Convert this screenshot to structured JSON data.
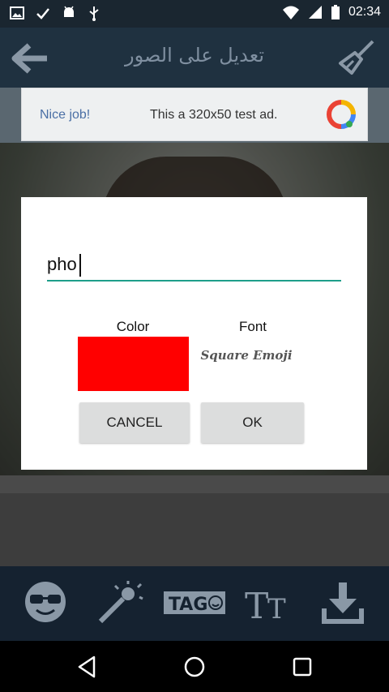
{
  "status_bar": {
    "time": "02:34",
    "icons": [
      "image-icon",
      "check-icon",
      "android-icon",
      "usb-icon",
      "wifi-icon",
      "signal-icon",
      "battery-icon"
    ]
  },
  "app_bar": {
    "title": "تعديل على الصور"
  },
  "ad": {
    "nice_job": "Nice job!",
    "text": "This a 320x50 test ad."
  },
  "dialog": {
    "input_value": "pho",
    "color_label": "Color",
    "font_label": "Font",
    "color_value": "#ff0000",
    "font_name": "Square Emoji",
    "cancel_label": "CANCEL",
    "ok_label": "OK"
  },
  "tools": {
    "tag_label": "TAG"
  },
  "colors": {
    "accent": "#1e9e8a",
    "toolbar": "#1f3140",
    "tools_bar": "#152230",
    "icon": "#8a98a6"
  }
}
